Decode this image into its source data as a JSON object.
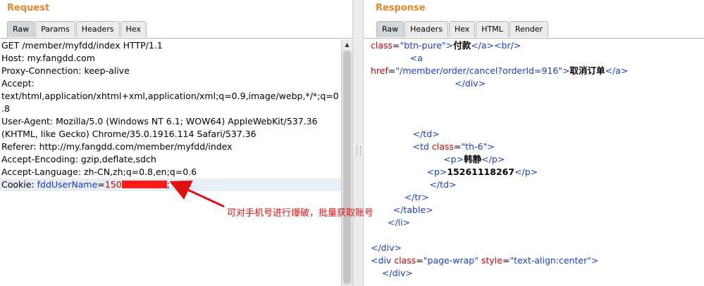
{
  "request": {
    "title": "Request",
    "tabs": [
      "Raw",
      "Params",
      "Headers",
      "Hex"
    ],
    "active_tab": "Raw",
    "lines": [
      "GET /member/myfdd/index HTTP/1.1",
      "Host: my.fangdd.com",
      "Proxy-Connection: keep-alive",
      "Accept:",
      "text/html,application/xhtml+xml,application/xml;q=0.9,image/webp,*/*;q=0",
      ".8",
      "User-Agent: Mozilla/5.0 (Windows NT 6.1; WOW64) AppleWebKit/537.36",
      "(KHTML, like Gecko) Chrome/35.0.1916.114 Safari/537.36",
      "Referer: http://my.fangdd.com/member/myfdd/index",
      "Accept-Encoding: gzip,deflate,sdch",
      "Accept-Language: zh-CN,zh;q=0.8,en;q=0.6"
    ],
    "cookie": {
      "key": "Cookie: ",
      "name": "fddUserName",
      "eq": "=",
      "value_visible": "150",
      "tail": ";"
    }
  },
  "response": {
    "title": "Response",
    "tabs": [
      "Raw",
      "Headers",
      "Hex",
      "HTML",
      "Render"
    ],
    "active_tab": "Raw"
  },
  "annotation": {
    "text": "可对手机号进行爆破，批量获取账号",
    "color": "#e01010"
  },
  "colors": {
    "pane_title": "#e8852a",
    "tag_blue": "#1a3cc8",
    "attr_red": "#c80000",
    "redaction": "#ff1a1a"
  }
}
